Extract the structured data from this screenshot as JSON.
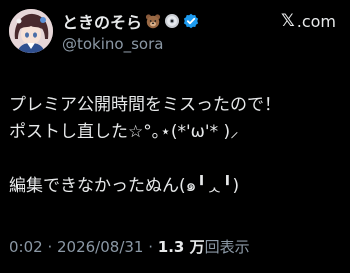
{
  "user": {
    "display_name": "ときのそら",
    "handle": "@tokino_sora",
    "name_emojis": [
      "bear-emoji",
      "disc-emoji"
    ],
    "verified_color": "#1d9bf0"
  },
  "brand": {
    "x": "𝕏",
    "label": ".com"
  },
  "post": {
    "lines": [
      "プレミア公開時間をミスったので！",
      "ポストし直した☆°｡⋆(*'ω'* )⸝",
      "",
      "編集できなかったぬん(๑╹ᆺ╹)"
    ]
  },
  "meta": {
    "time": "0:02",
    "separator1": " · ",
    "date": "2026/08/31",
    "separator2": " · ",
    "views_number": "1.3 万",
    "views_label": "回表示"
  },
  "colors": {
    "background": "#000000",
    "text": "#e7e9ea",
    "muted": "#8b98a5",
    "accent": "#1d9bf0"
  }
}
